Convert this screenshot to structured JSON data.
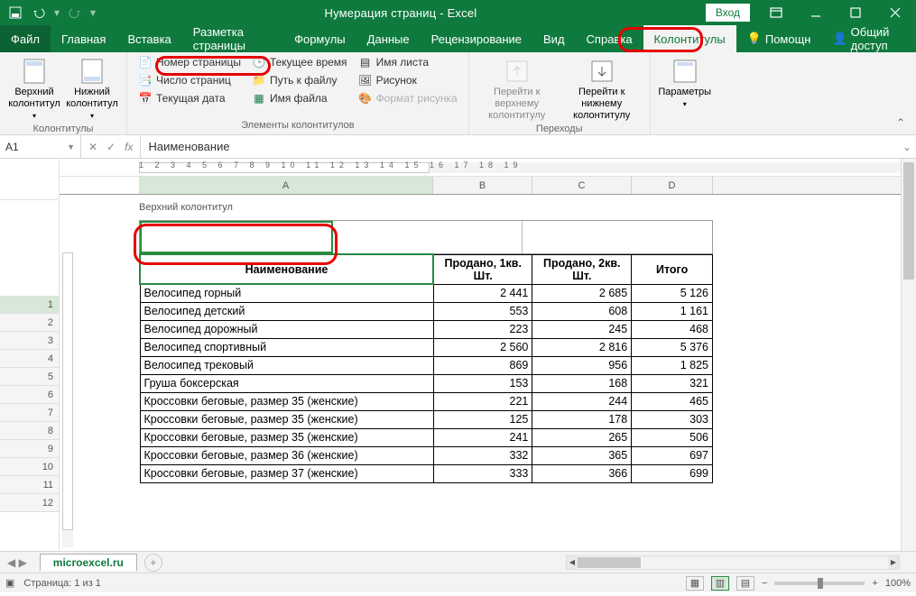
{
  "titlebar": {
    "title": "Нумерация страниц  -  Excel",
    "login": "Вход"
  },
  "tabs": {
    "file": "Файл",
    "home": "Главная",
    "insert": "Вставка",
    "pagelayout": "Разметка страницы",
    "formulas": "Формулы",
    "data": "Данные",
    "review": "Рецензирование",
    "view": "Вид",
    "help": "Справка",
    "headerfooter": "Колонтитулы",
    "tellme": "Помощн",
    "share": "Общий доступ"
  },
  "ribbon": {
    "group1": {
      "title": "Колонтитулы",
      "header_btn": "Верхний\nколонтитул",
      "footer_btn": "Нижний\nколонтитул"
    },
    "group2": {
      "title": "Элементы колонтитулов",
      "page_number": "Номер страницы",
      "page_count": "Число страниц",
      "current_date": "Текущая дата",
      "current_time": "Текущее время",
      "file_path": "Путь к файлу",
      "file_name": "Имя файла",
      "sheet_name": "Имя листа",
      "picture": "Рисунок",
      "format_picture": "Формат рисунка"
    },
    "group3": {
      "title": "Переходы",
      "goto_header": "Перейти к верхнему\nколонтитулу",
      "goto_footer": "Перейти к нижнему\nколонтитулу"
    },
    "group4": {
      "title": "",
      "options": "Параметры"
    }
  },
  "namebox": "A1",
  "formula": "Наименование",
  "colheads": {
    "A": "A",
    "B": "B",
    "C": "C",
    "D": "D"
  },
  "header_label": "Верхний колонтитул",
  "table": {
    "headers": {
      "name": "Наименование",
      "q1": "Продано, 1кв. Шт.",
      "q2": "Продано, 2кв. Шт.",
      "total": "Итого"
    },
    "rows": [
      {
        "n": "Велосипед горный",
        "a": "2 441",
        "b": "2 685",
        "c": "5 126"
      },
      {
        "n": "Велосипед детский",
        "a": "553",
        "b": "608",
        "c": "1 161"
      },
      {
        "n": "Велосипед дорожный",
        "a": "223",
        "b": "245",
        "c": "468"
      },
      {
        "n": "Велосипед спортивный",
        "a": "2 560",
        "b": "2 816",
        "c": "5 376"
      },
      {
        "n": "Велосипед трековый",
        "a": "869",
        "b": "956",
        "c": "1 825"
      },
      {
        "n": "Груша боксерская",
        "a": "153",
        "b": "168",
        "c": "321"
      },
      {
        "n": "Кроссовки беговые, размер 35 (женские)",
        "a": "221",
        "b": "244",
        "c": "465"
      },
      {
        "n": "Кроссовки беговые, размер 35 (женские)",
        "a": "125",
        "b": "178",
        "c": "303"
      },
      {
        "n": "Кроссовки беговые, размер 35 (женские)",
        "a": "241",
        "b": "265",
        "c": "506"
      },
      {
        "n": "Кроссовки беговые, размер 36 (женские)",
        "a": "332",
        "b": "365",
        "c": "697"
      },
      {
        "n": "Кроссовки беговые, размер 37 (женские)",
        "a": "333",
        "b": "366",
        "c": "699"
      }
    ]
  },
  "rownums": [
    "1",
    "2",
    "3",
    "4",
    "5",
    "6",
    "7",
    "8",
    "9",
    "10",
    "11",
    "12"
  ],
  "sheettab": "microexcel.ru",
  "status": {
    "page": "Страница: 1 из 1",
    "zoom": "100%"
  },
  "ruler_nums": "1    2    3    4    5    6    7    8    9    10   11   12   13   14   15   16   17   18   19"
}
